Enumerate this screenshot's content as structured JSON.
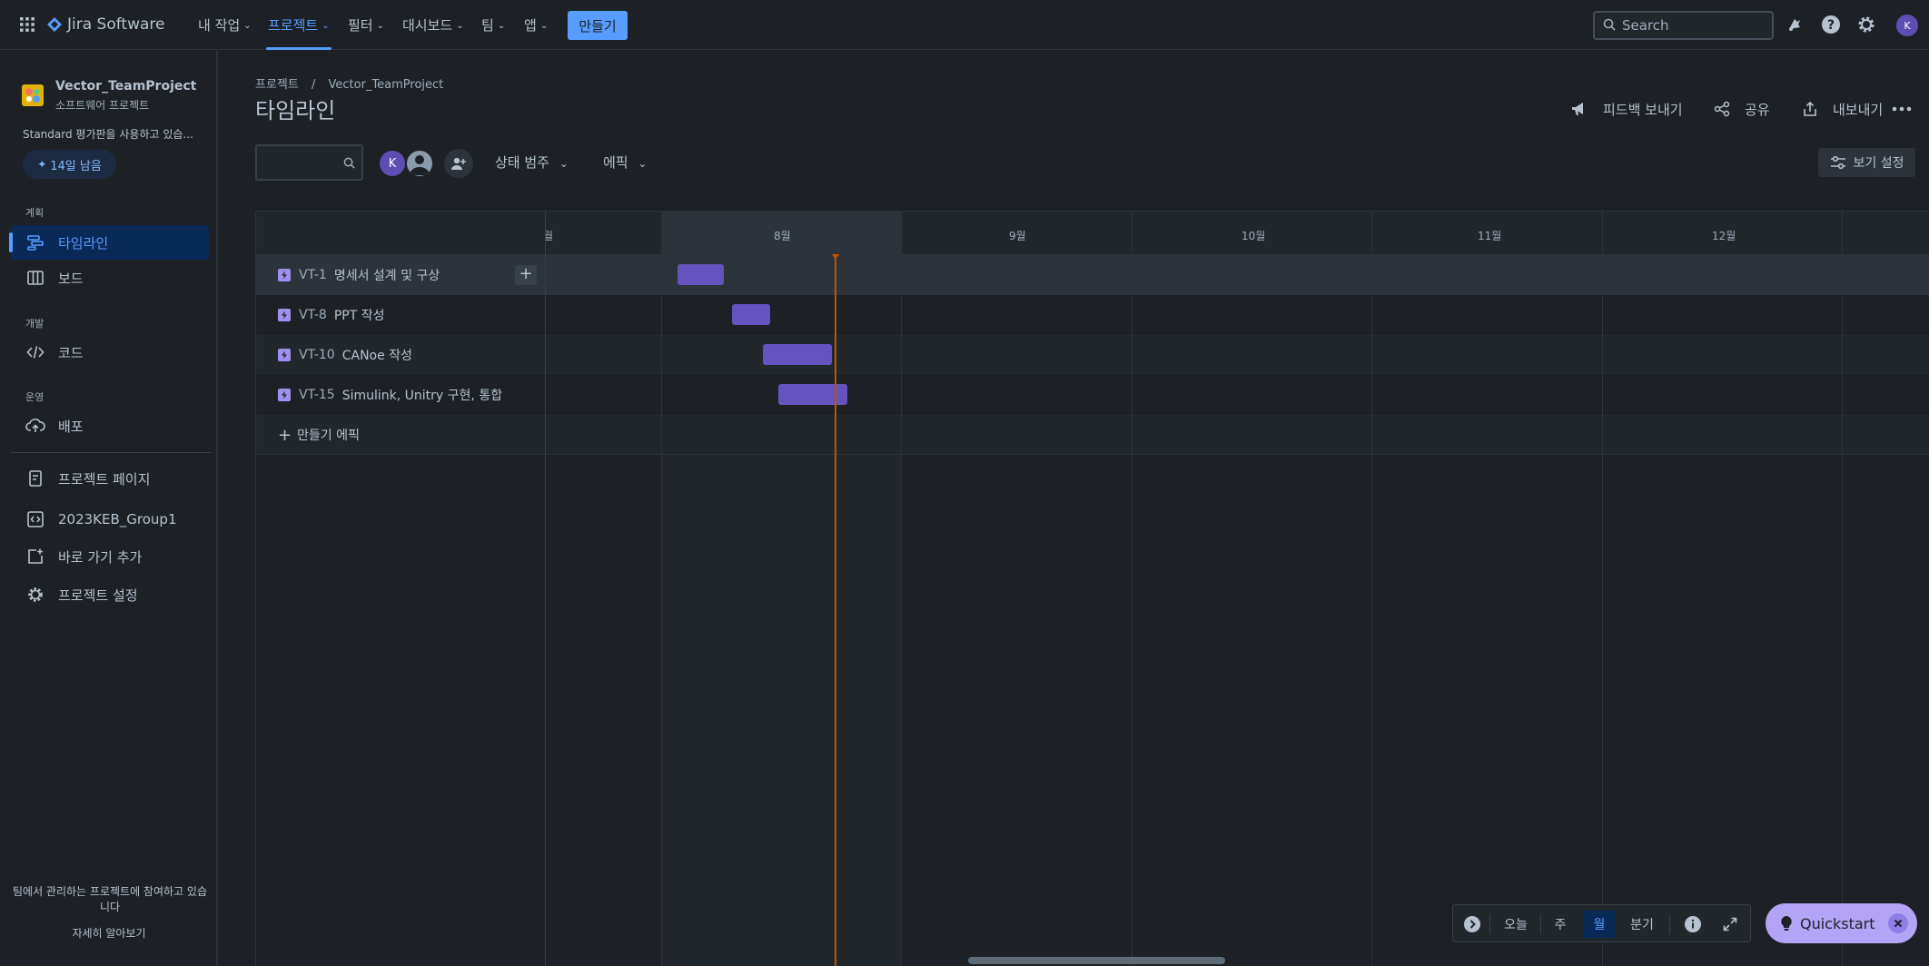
{
  "top_nav": {
    "product": "Jira Software",
    "items": [
      {
        "label": "내 작업"
      },
      {
        "label": "프로젝트"
      },
      {
        "label": "필터"
      },
      {
        "label": "대시보드"
      },
      {
        "label": "팀"
      },
      {
        "label": "앱"
      }
    ],
    "create_label": "만들기",
    "search_placeholder": "Search",
    "avatar_initial": "K"
  },
  "sidebar": {
    "project_name": "Vector_TeamProject",
    "project_type": "소프트웨어 프로젝트",
    "trial_text": "Standard 평가판을 사용하고 있습...",
    "trial_button": "14일 남음",
    "section_plan": "계획",
    "section_dev": "개발",
    "section_ops": "운영",
    "items": [
      {
        "label": "타임라인",
        "icon": "timeline-icon"
      },
      {
        "label": "보드",
        "icon": "board-icon"
      },
      {
        "label": "코드",
        "icon": "code-icon"
      },
      {
        "label": "배포",
        "icon": "deploy-icon"
      },
      {
        "label": "프로젝트 페이지",
        "icon": "page-icon"
      },
      {
        "label": "2023KEB_Group1",
        "icon": "repo-icon"
      },
      {
        "label": "바로 가기 추가",
        "icon": "add-shortcut-icon"
      },
      {
        "label": "프로젝트 설정",
        "icon": "settings-icon"
      }
    ],
    "footer_text": "팀에서 관리하는 프로젝트에 참여하고 있습니다",
    "footer_link": "자세히 알아보기"
  },
  "page": {
    "breadcrumb_root": "프로젝트",
    "breadcrumb_sep": "/",
    "breadcrumb_project": "Vector_TeamProject",
    "title": "타임라인",
    "actions": {
      "feedback": "피드백 보내기",
      "share": "공유",
      "export": "내보내기"
    },
    "filters": {
      "avatar_initial": "K",
      "status_category": "상태 범주",
      "epic": "에픽",
      "view_settings": "보기 설정"
    }
  },
  "timeline": {
    "months": [
      "8월",
      "9월",
      "10월",
      "11월",
      "12월"
    ],
    "partial_month": "월",
    "epics": [
      {
        "key": "VT-1",
        "title": "명세서 설계 및 구상"
      },
      {
        "key": "VT-8",
        "title": "PPT 작성"
      },
      {
        "key": "VT-10",
        "title": "CANoe 작성"
      },
      {
        "key": "VT-15",
        "title": "Simulink, Unitry 구현, 통합"
      }
    ],
    "create_epic": "만들기 에픽"
  },
  "controls": {
    "today": "오늘",
    "week": "주",
    "month": "월",
    "quarter": "분기",
    "quickstart": "Quickstart"
  },
  "colors": {
    "accent": "#579dff",
    "epic_bar": "#6554c0",
    "today_line": "#c25100",
    "background": "#1d2125"
  }
}
